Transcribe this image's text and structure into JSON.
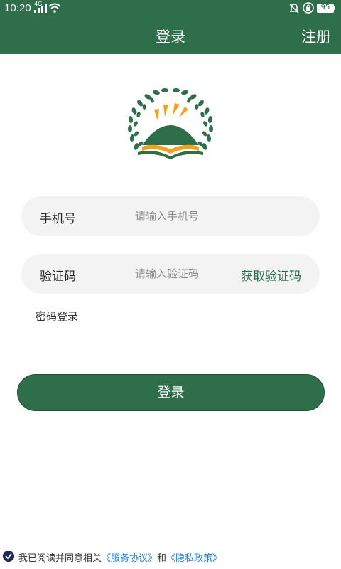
{
  "status_bar": {
    "time": "10:20",
    "network": "4G",
    "battery": "95",
    "icons": [
      "signal-icon",
      "wifi-icon",
      "bell-off-icon",
      "lock-icon",
      "battery-icon"
    ]
  },
  "app_bar": {
    "title": "登录",
    "register_label": "注册"
  },
  "logo": {
    "icon": "wheat-mountain-logo"
  },
  "form": {
    "phone_label": "手机号",
    "phone_placeholder": "请输入手机号",
    "code_label": "验证码",
    "code_placeholder": "请输入验证码",
    "get_code_label": "获取验证码",
    "password_login_label": "密码登录",
    "login_button_label": "登录"
  },
  "agreement": {
    "prefix": "我已阅读并同意相关",
    "service_link": "《服务协议》",
    "conjunction": "和",
    "privacy_link": "《隐私政策》",
    "checked": true
  },
  "colors": {
    "primary": "#2f6e4a",
    "link": "#2a7bd0",
    "field_bg": "#f3f3f3",
    "logo_orange": "#f0a21b"
  }
}
